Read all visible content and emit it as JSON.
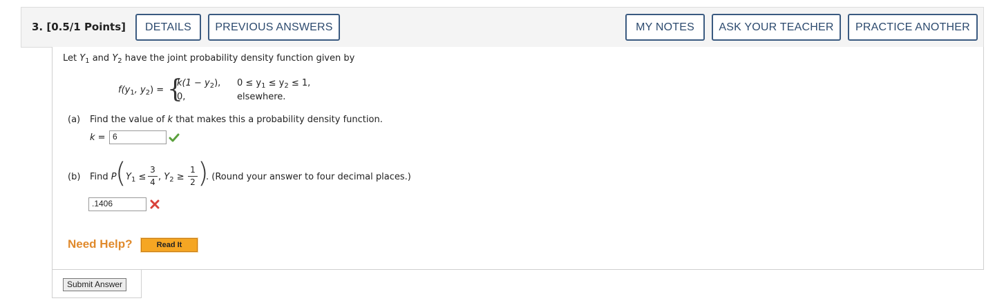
{
  "question": {
    "number": "3.",
    "points": "[0.5/1 Points]"
  },
  "header_buttons": {
    "details": "DETAILS",
    "previous_answers": "PREVIOUS ANSWERS",
    "my_notes": "MY NOTES",
    "ask_teacher": "ASK YOUR TEACHER",
    "practice_another": "PRACTICE ANOTHER"
  },
  "problem": {
    "intro_pre": "Let ",
    "Y": "Y",
    "sub1": "1",
    "sub2": "2",
    "and": " and ",
    "intro_post": " have the joint probability density function given by",
    "func_lhs": "f(y",
    "func_lhs_mid": ", y",
    "func_lhs_end": ") =",
    "case1_expr_a": "k(1 − y",
    "case1_expr_b": "),",
    "case1_cond_a": "0 ≤ y",
    "case1_cond_b": " ≤ y",
    "case1_cond_c": " ≤ 1,",
    "case2_expr": "0,",
    "case2_cond": "elsewhere."
  },
  "part_a": {
    "label": "(a)",
    "text_pre": "Find the value of ",
    "k": "k",
    "text_post": " that makes this a probability density function.",
    "answer_label": "k",
    "equals": "=",
    "answer_value": "6",
    "status": "correct"
  },
  "part_b": {
    "label": "(b)",
    "find": "Find ",
    "P": "P",
    "Y": "Y",
    "sub1": "1",
    "sub2": "2",
    "le": "≤",
    "ge": "≥",
    "comma": ",",
    "frac1_num": "3",
    "frac1_den": "4",
    "frac2_num": "1",
    "frac2_den": "2",
    "tail": ". (Round your answer to four decimal places.)",
    "answer_value": ".1406",
    "status": "incorrect"
  },
  "help": {
    "label": "Need Help?",
    "read_it": "Read It"
  },
  "submit": {
    "label": "Submit Answer"
  },
  "colors": {
    "button_border": "#3a5a80",
    "check": "#5aa03c",
    "cross": "#d9413a",
    "help": "#e08a2c",
    "read_it_bg": "#f5a623"
  }
}
